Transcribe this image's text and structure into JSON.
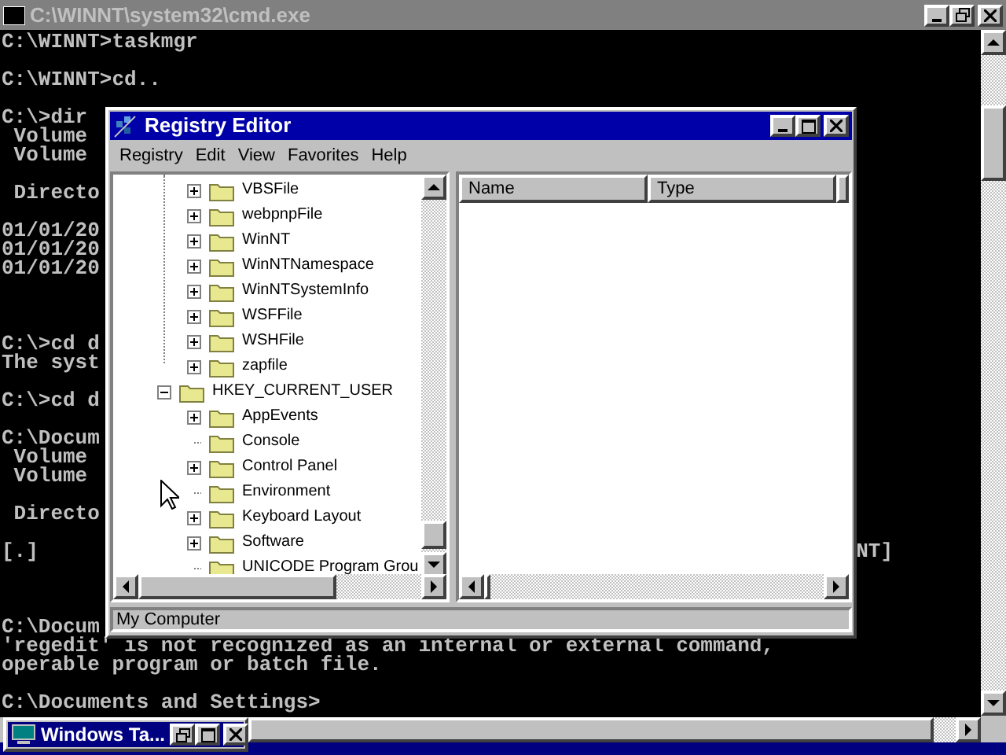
{
  "console_window": {
    "title": "C:\\WINNT\\system32\\cmd.exe",
    "active": false,
    "lines": [
      {
        "kind": "text",
        "text": "C:\\WINNT>taskmgr"
      },
      {
        "kind": "blank"
      },
      {
        "kind": "text",
        "text": "C:\\WINNT>cd.."
      },
      {
        "kind": "blank"
      },
      {
        "kind": "text",
        "text": "C:\\>dir"
      },
      {
        "kind": "text",
        "text": " Volume"
      },
      {
        "kind": "text",
        "text": " Volume"
      },
      {
        "kind": "blank"
      },
      {
        "kind": "text",
        "text": " Directo"
      },
      {
        "kind": "blank"
      },
      {
        "kind": "text",
        "text": "01/01/20"
      },
      {
        "kind": "text",
        "text": "01/01/20"
      },
      {
        "kind": "text",
        "text": "01/01/20"
      },
      {
        "kind": "blank"
      },
      {
        "kind": "blank"
      },
      {
        "kind": "blank"
      },
      {
        "kind": "text",
        "text": "C:\\>cd d"
      },
      {
        "kind": "text",
        "text": "The syst"
      },
      {
        "kind": "blank"
      },
      {
        "kind": "text",
        "text": "C:\\>cd d"
      },
      {
        "kind": "blank"
      },
      {
        "kind": "text",
        "text": "C:\\Docum"
      },
      {
        "kind": "text",
        "text": " Volume"
      },
      {
        "kind": "text",
        "text": " Volume"
      },
      {
        "kind": "blank"
      },
      {
        "kind": "text",
        "text": " Directo"
      },
      {
        "kind": "blank"
      },
      {
        "kind": "text",
        "text": "[.]",
        "right_text": "NT]"
      },
      {
        "kind": "blank"
      },
      {
        "kind": "blank"
      },
      {
        "kind": "blank"
      },
      {
        "kind": "text",
        "text": "C:\\Docum"
      },
      {
        "kind": "text",
        "text": "'regedit' is not recognized as an internal or external command,"
      },
      {
        "kind": "text",
        "text": "operable program or batch file."
      },
      {
        "kind": "blank"
      },
      {
        "kind": "text",
        "text": "C:\\Documents and Settings>"
      }
    ]
  },
  "registry_editor": {
    "title": "Registry Editor",
    "active": true,
    "menu": [
      "Registry",
      "Edit",
      "View",
      "Favorites",
      "Help"
    ],
    "tree": [
      {
        "children": [
          {
            "label": "VBSFile",
            "expandable": true,
            "expanded": false
          },
          {
            "label": "webpnpFile",
            "expandable": true,
            "expanded": false
          },
          {
            "label": "WinNT",
            "expandable": true,
            "expanded": false
          },
          {
            "label": "WinNTNamespace",
            "expandable": true,
            "expanded": false
          },
          {
            "label": "WinNTSystemInfo",
            "expandable": true,
            "expanded": false
          },
          {
            "label": "WSFFile",
            "expandable": true,
            "expanded": false
          },
          {
            "label": "WSHFile",
            "expandable": true,
            "expanded": false
          },
          {
            "label": "zapfile",
            "expandable": true,
            "expanded": false
          }
        ]
      },
      {
        "label": "HKEY_CURRENT_USER",
        "expandable": true,
        "expanded": true,
        "children": [
          {
            "label": "AppEvents",
            "expandable": true,
            "expanded": false
          },
          {
            "label": "Console",
            "expandable": false
          },
          {
            "label": "Control Panel",
            "expandable": true,
            "expanded": false
          },
          {
            "label": "Environment",
            "expandable": false
          },
          {
            "label": "Keyboard Layout",
            "expandable": true,
            "expanded": false
          },
          {
            "label": "Software",
            "expandable": true,
            "expanded": false
          },
          {
            "label": "UNICODE Program Grou",
            "expandable": false
          }
        ]
      }
    ],
    "columns": [
      "Name",
      "Type"
    ],
    "status_bar": "My Computer"
  },
  "minimized_window": {
    "title": "Windows Ta..."
  }
}
